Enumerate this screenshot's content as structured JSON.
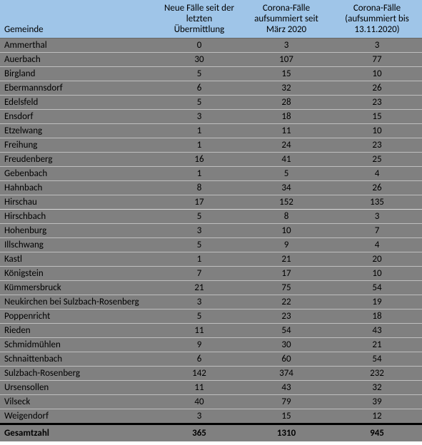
{
  "headers": {
    "gemeinde": "Gemeinde",
    "neue": "Neue Fälle seit der letzten Übermittlung",
    "aufsummiert": "Corona-Fälle aufsummiert seit März 2020",
    "bis": "Corona-Fälle (aufsummiert bis 13.11.2020)"
  },
  "rows": [
    {
      "g": "Ammerthal",
      "n": "0",
      "a": "3",
      "b": "3"
    },
    {
      "g": "Auerbach",
      "n": "30",
      "a": "107",
      "b": "77"
    },
    {
      "g": "Birgland",
      "n": "5",
      "a": "15",
      "b": "10"
    },
    {
      "g": "Ebermannsdorf",
      "n": "6",
      "a": "32",
      "b": "26"
    },
    {
      "g": "Edelsfeld",
      "n": "5",
      "a": "28",
      "b": "23"
    },
    {
      "g": "Ensdorf",
      "n": "3",
      "a": "18",
      "b": "15"
    },
    {
      "g": "Etzelwang",
      "n": "1",
      "a": "11",
      "b": "10"
    },
    {
      "g": "Freihung",
      "n": "1",
      "a": "24",
      "b": "23"
    },
    {
      "g": "Freudenberg",
      "n": "16",
      "a": "41",
      "b": "25"
    },
    {
      "g": "Gebenbach",
      "n": "1",
      "a": "5",
      "b": "4"
    },
    {
      "g": "Hahnbach",
      "n": "8",
      "a": "34",
      "b": "26"
    },
    {
      "g": "Hirschau",
      "n": "17",
      "a": "152",
      "b": "135"
    },
    {
      "g": "Hirschbach",
      "n": "5",
      "a": "8",
      "b": "3"
    },
    {
      "g": "Hohenburg",
      "n": "3",
      "a": "10",
      "b": "7"
    },
    {
      "g": "Illschwang",
      "n": "5",
      "a": "9",
      "b": "4"
    },
    {
      "g": "Kastl",
      "n": "1",
      "a": "21",
      "b": "20"
    },
    {
      "g": "Königstein",
      "n": "7",
      "a": "17",
      "b": "10"
    },
    {
      "g": "Kümmersbruck",
      "n": "21",
      "a": "75",
      "b": "54"
    },
    {
      "g": "Neukirchen bei Sulzbach-Rosenberg",
      "n": "3",
      "a": "22",
      "b": "19"
    },
    {
      "g": "Poppenricht",
      "n": "5",
      "a": "23",
      "b": "18"
    },
    {
      "g": "Rieden",
      "n": "11",
      "a": "54",
      "b": "43"
    },
    {
      "g": "Schmidmühlen",
      "n": "9",
      "a": "30",
      "b": "21"
    },
    {
      "g": "Schnaittenbach",
      "n": "6",
      "a": "60",
      "b": "54"
    },
    {
      "g": "Sulzbach-Rosenberg",
      "n": "142",
      "a": "374",
      "b": "232"
    },
    {
      "g": "Ursensollen",
      "n": "11",
      "a": "43",
      "b": "32"
    },
    {
      "g": "Vilseck",
      "n": "40",
      "a": "79",
      "b": "39"
    },
    {
      "g": "Weigendorf",
      "n": "3",
      "a": "15",
      "b": "12"
    }
  ],
  "total": {
    "g": "Gesamtzahl",
    "n": "365",
    "a": "1310",
    "b": "945"
  },
  "chart_data": {
    "type": "table",
    "title": "Corona-Fälle nach Gemeinde",
    "columns": [
      "Gemeinde",
      "Neue Fälle seit der letzten Übermittlung",
      "Corona-Fälle aufsummiert seit März 2020",
      "Corona-Fälle (aufsummiert bis 13.11.2020)"
    ],
    "data": [
      [
        "Ammerthal",
        0,
        3,
        3
      ],
      [
        "Auerbach",
        30,
        107,
        77
      ],
      [
        "Birgland",
        5,
        15,
        10
      ],
      [
        "Ebermannsdorf",
        6,
        32,
        26
      ],
      [
        "Edelsfeld",
        5,
        28,
        23
      ],
      [
        "Ensdorf",
        3,
        18,
        15
      ],
      [
        "Etzelwang",
        1,
        11,
        10
      ],
      [
        "Freihung",
        1,
        24,
        23
      ],
      [
        "Freudenberg",
        16,
        41,
        25
      ],
      [
        "Gebenbach",
        1,
        5,
        4
      ],
      [
        "Hahnbach",
        8,
        34,
        26
      ],
      [
        "Hirschau",
        17,
        152,
        135
      ],
      [
        "Hirschbach",
        5,
        8,
        3
      ],
      [
        "Hohenburg",
        3,
        10,
        7
      ],
      [
        "Illschwang",
        5,
        9,
        4
      ],
      [
        "Kastl",
        1,
        21,
        20
      ],
      [
        "Königstein",
        7,
        17,
        10
      ],
      [
        "Kümmersbruck",
        21,
        75,
        54
      ],
      [
        "Neukirchen bei Sulzbach-Rosenberg",
        3,
        22,
        19
      ],
      [
        "Poppenricht",
        5,
        23,
        18
      ],
      [
        "Rieden",
        11,
        54,
        43
      ],
      [
        "Schmidmühlen",
        9,
        30,
        21
      ],
      [
        "Schnaittenbach",
        6,
        60,
        54
      ],
      [
        "Sulzbach-Rosenberg",
        142,
        374,
        232
      ],
      [
        "Ursensollen",
        11,
        43,
        32
      ],
      [
        "Vilseck",
        40,
        79,
        39
      ],
      [
        "Weigendorf",
        3,
        15,
        12
      ],
      [
        "Gesamtzahl",
        365,
        1310,
        945
      ]
    ]
  }
}
